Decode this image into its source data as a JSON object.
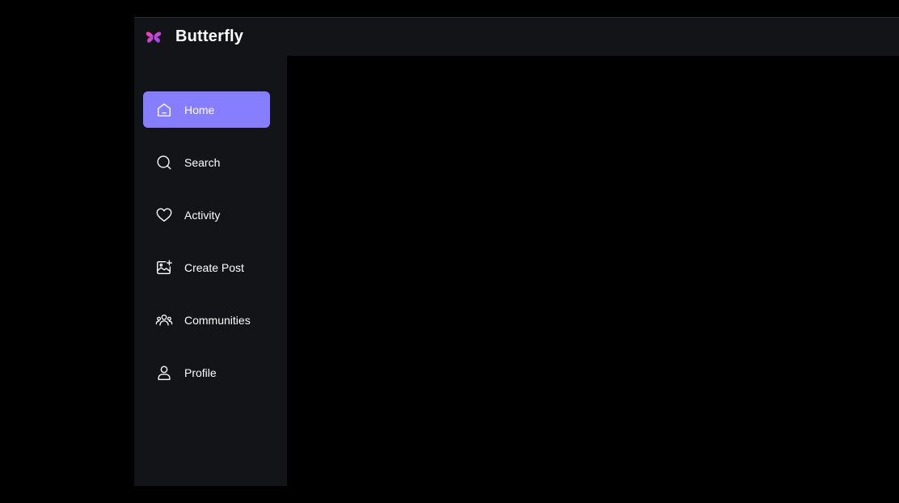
{
  "header": {
    "app_name": "Butterfly",
    "logo_icon": "butterfly-icon"
  },
  "colors": {
    "accent": "#877eff",
    "sidebar_bg": "#121417",
    "page_bg": "#000000",
    "text": "#ffffff",
    "logo_pink": "#ff3db5",
    "logo_purple": "#8a4dff"
  },
  "sidebar": {
    "items": [
      {
        "label": "Home",
        "icon": "home-icon",
        "active": true
      },
      {
        "label": "Search",
        "icon": "search-icon",
        "active": false
      },
      {
        "label": "Activity",
        "icon": "heart-icon",
        "active": false
      },
      {
        "label": "Create Post",
        "icon": "image-plus-icon",
        "active": false
      },
      {
        "label": "Communities",
        "icon": "people-icon",
        "active": false
      },
      {
        "label": "Profile",
        "icon": "user-icon",
        "active": false
      }
    ]
  }
}
